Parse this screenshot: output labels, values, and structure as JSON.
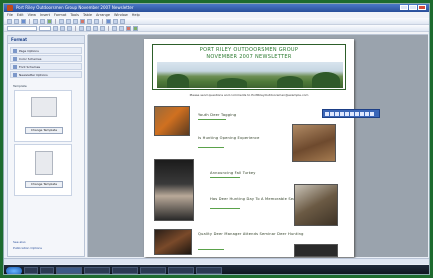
{
  "window": {
    "title": "Port Riley Outdoorsmen Group November 2007 Newsletter",
    "menu": [
      "File",
      "Edit",
      "View",
      "Insert",
      "Format",
      "Tools",
      "Table",
      "Arrange",
      "Window",
      "Help"
    ]
  },
  "toolbar": {
    "font_field": "",
    "size_field": ""
  },
  "sidebar": {
    "title": "Format",
    "items": [
      {
        "label": "Page Options"
      },
      {
        "label": "Color Schemes"
      },
      {
        "label": "Font Schemes"
      },
      {
        "label": "Newsletter Options"
      }
    ],
    "section_label": "Template",
    "template_button": "Change Template",
    "preview_button": "Change Template",
    "bottom_link_1": "See also",
    "bottom_link_2": "Publication Options"
  },
  "newsletter": {
    "banner_line1": "PORT RILEY OUTDOORSMEN GROUP",
    "banner_line2": "NOVEMBER 2007 NEWSLETTER",
    "tagline": "Please send questions and comments to PortRileyOutdoorsmen@example.com",
    "stories": [
      {
        "title": "Youth Deer Tagging"
      },
      {
        "title": "Is Hunting Opening Experience"
      },
      {
        "title": "Announcing Fall Turkey"
      },
      {
        "title": "Has Deer Hunting Day To A Memorable Season?"
      },
      {
        "title": "Quality Deer Manager Attends Seminar Deer Hunting"
      }
    ]
  },
  "statusbar": {
    "text": ""
  },
  "taskbar": {
    "clock": ""
  },
  "colors": {
    "accent": "#2b7a2f",
    "taskbar": "#0b111a",
    "frame_border": "#1d6b2e"
  }
}
